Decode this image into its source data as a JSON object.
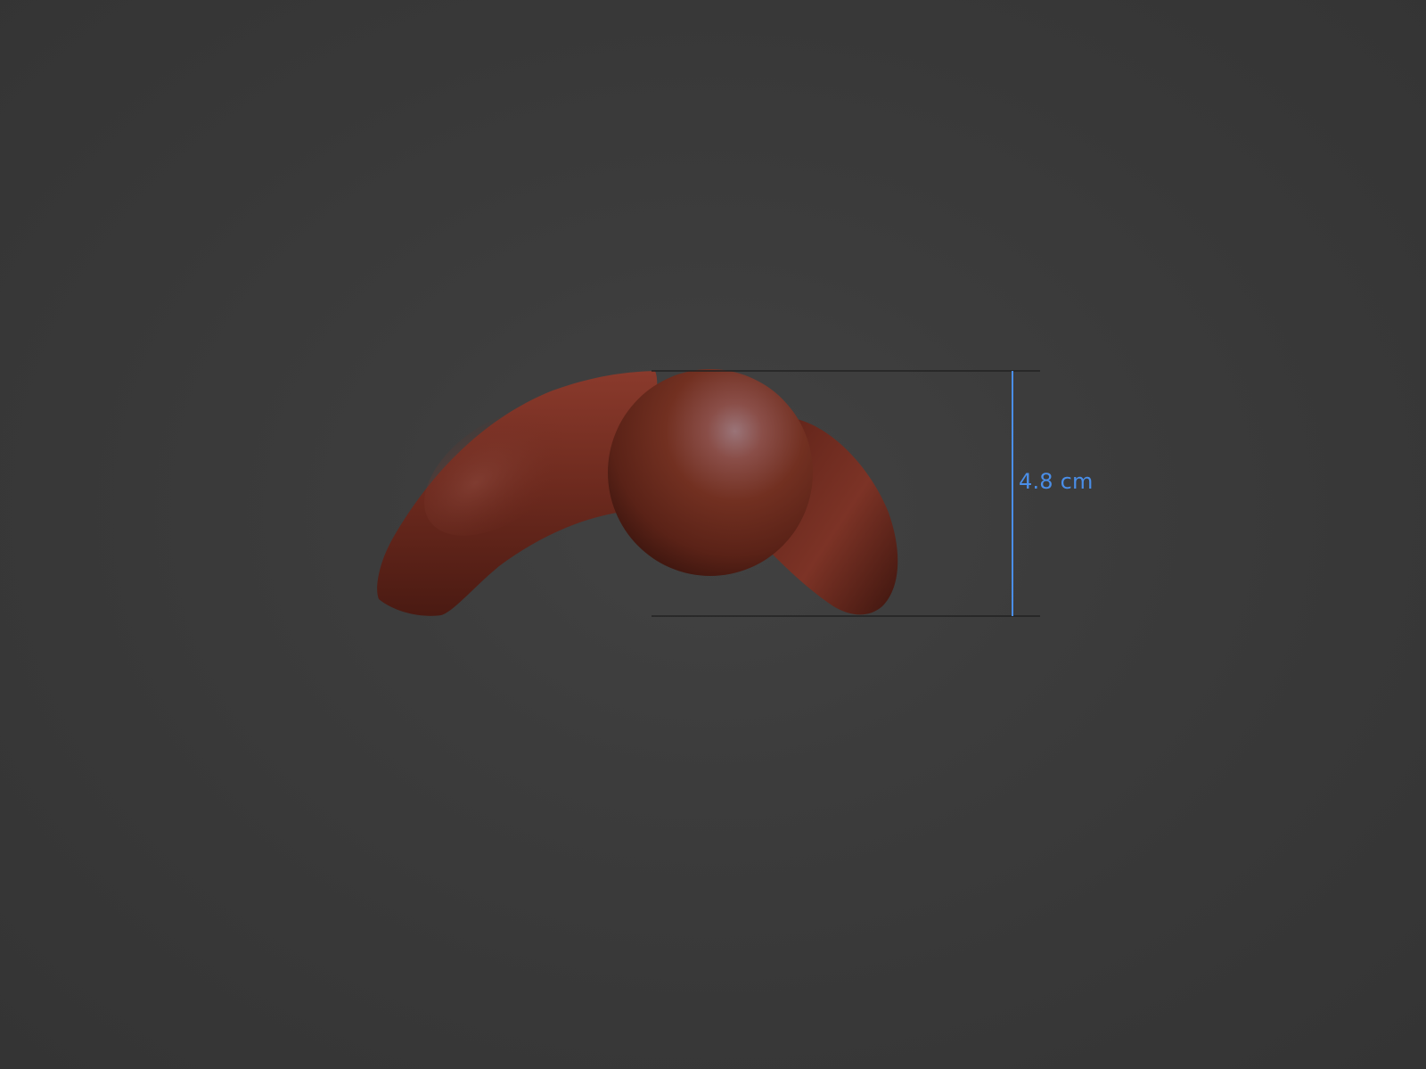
{
  "viewport": {
    "background_color": "#3a3a3a",
    "model_color": "#6a2a1e",
    "model_highlight_color": "#9a6f72",
    "dimension_line_color": "#4a8ee8",
    "guide_line_color": "#222222"
  },
  "dimension": {
    "label": "4.8 cm",
    "axis": "height"
  }
}
